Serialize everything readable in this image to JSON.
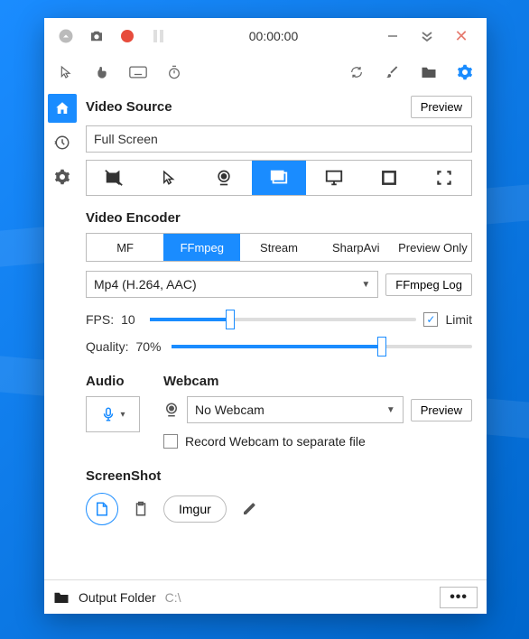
{
  "timer": "00:00:00",
  "sections": {
    "video_source": "Video Source",
    "video_encoder": "Video Encoder",
    "audio": "Audio",
    "webcam": "Webcam",
    "screenshot": "ScreenShot"
  },
  "buttons": {
    "preview": "Preview",
    "ffmpeg_log": "FFmpeg Log",
    "webcam_preview": "Preview",
    "imgur": "Imgur",
    "more": "•••"
  },
  "video_source": {
    "value": "Full Screen"
  },
  "encoder_tabs": {
    "mf": "MF",
    "ffmpeg": "FFmpeg",
    "stream": "Stream",
    "sharpavi": "SharpAvi",
    "preview_only": "Preview Only"
  },
  "encoder_format": "Mp4 (H.264, AAC)",
  "fps": {
    "label": "FPS:",
    "value": "10",
    "percent": 30,
    "limit_label": "Limit",
    "limit_checked": "✓"
  },
  "quality": {
    "label": "Quality:",
    "value": "70%",
    "percent": 70
  },
  "webcam": {
    "value": "No Webcam",
    "separate_label": "Record Webcam to separate file"
  },
  "footer": {
    "label": "Output Folder",
    "value": "C:\\"
  }
}
